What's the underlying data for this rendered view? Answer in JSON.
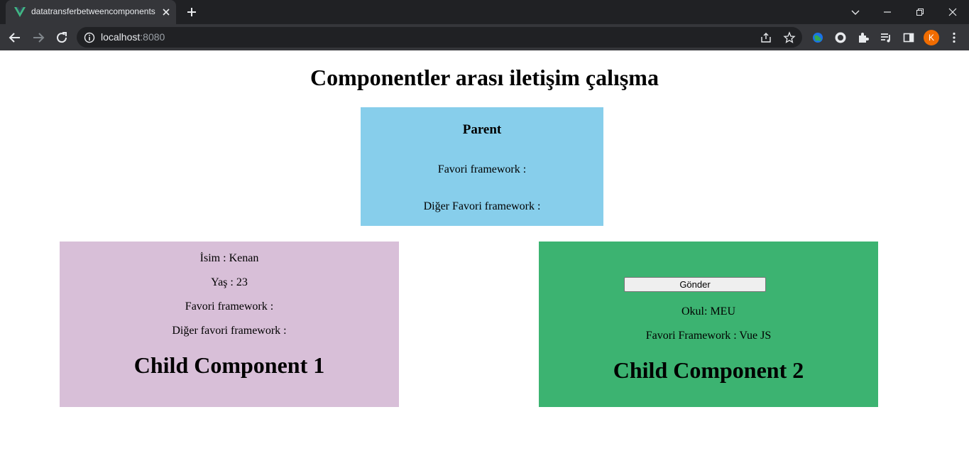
{
  "browser": {
    "tab_title": "datatransferbetweencomponents",
    "url_host": "localhost",
    "url_port": ":8080",
    "profile_initial": "K",
    "accent_profile": "#f06c00",
    "tab_favicon": "vue-logo-icon"
  },
  "page": {
    "title": "Componentler arası iletişim çalışma"
  },
  "parent": {
    "heading": "Parent",
    "favorite_label": "Favori framework :",
    "other_favorite_label": "Diğer Favori framework :",
    "bg_color": "#87ceeb"
  },
  "child1": {
    "name_line": "İsim : Kenan",
    "age_line": "Yaş : 23",
    "favorite_line": "Favori framework :",
    "other_favorite_line": "Diğer favori framework :",
    "heading": "Child Component 1",
    "bg_color": "#d8bfd8"
  },
  "child2": {
    "send_button": "Gönder",
    "school_line": "Okul: MEU",
    "favorite_line": "Favori Framework : Vue JS",
    "heading": "Child Component 2",
    "bg_color": "#3cb371"
  }
}
